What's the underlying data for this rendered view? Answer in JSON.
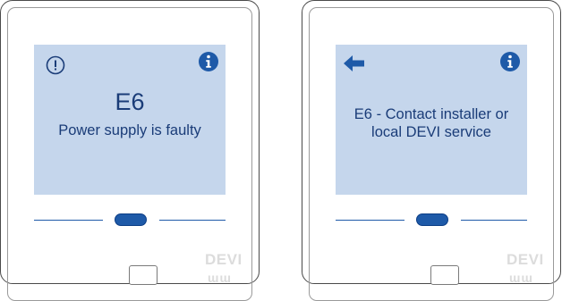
{
  "screens": [
    {
      "left_icon": "alert-icon",
      "right_icon": "info-icon",
      "code": "E6",
      "message": "Power supply is faulty"
    },
    {
      "left_icon": "back-arrow-icon",
      "right_icon": "info-icon",
      "message_line1": "E6 - Contact installer or",
      "message_line2": "local DEVI service"
    }
  ],
  "brand": {
    "name": "DEVI",
    "mark": "ɯɯ"
  },
  "colors": {
    "screen": "#c5d6ec",
    "accent": "#1e5aa8",
    "text": "#1a3c78"
  }
}
